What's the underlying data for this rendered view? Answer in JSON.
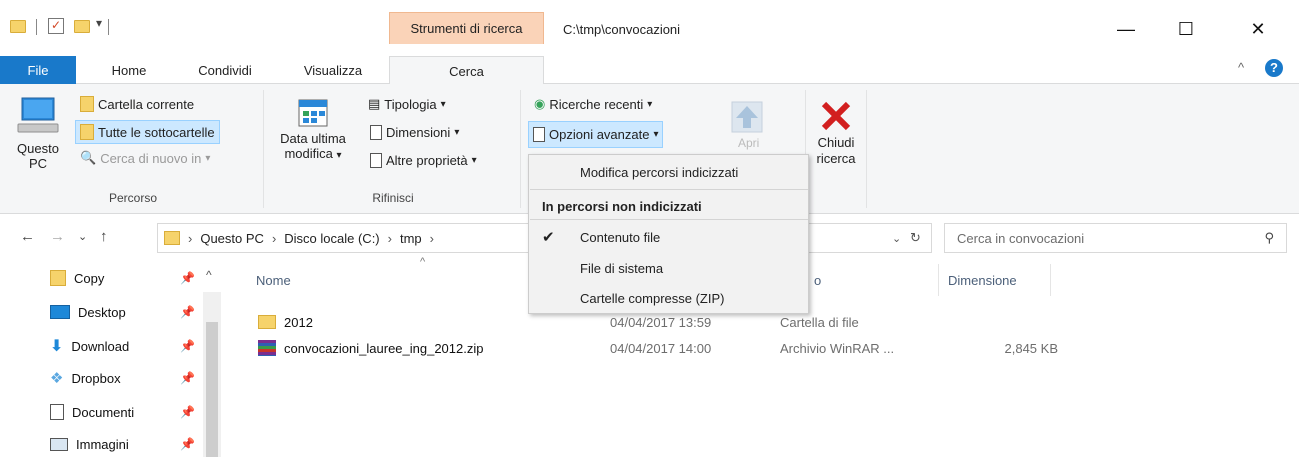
{
  "window": {
    "context_tab_header": "Strumenti di ricerca",
    "path_title": "C:\\tmp\\convocazioni",
    "minimize": "—",
    "maximize": "☐",
    "close": "✕"
  },
  "tabs": {
    "file": "File",
    "home": "Home",
    "condividi": "Condividi",
    "visualizza": "Visualizza",
    "cerca": "Cerca"
  },
  "ribbon": {
    "percorso": {
      "questo_pc": "Questo PC",
      "cartella_corrente": "Cartella corrente",
      "tutte_sottocartelle": "Tutte le sottocartelle",
      "cerca_di_nuovo": "Cerca di nuovo in",
      "label": "Percorso"
    },
    "rifinisci": {
      "data_ultima_modifica_1": "Data ultima",
      "data_ultima_modifica_2": "modifica",
      "tipologia": "Tipologia",
      "dimensioni": "Dimensioni",
      "altre_proprieta": "Altre proprietà",
      "label": "Rifinisci"
    },
    "opzioni": {
      "ricerche_recenti": "Ricerche recenti",
      "opzioni_avanzate": "Opzioni avanzate",
      "apri_label": "Apri"
    },
    "chiudi": {
      "line1": "Chiudi",
      "line2": "ricerca"
    }
  },
  "dropdown": {
    "modifica_percorsi": "Modifica percorsi indicizzati",
    "header": "In percorsi non indicizzati",
    "contenuto_file": "Contenuto file",
    "contenuto_file_checked": true,
    "file_di_sistema": "File di sistema",
    "cartelle_compresse": "Cartelle compresse (ZIP)"
  },
  "navbar": {
    "breadcrumb": [
      "Questo PC",
      "Disco locale (C:)",
      "tmp"
    ],
    "search_placeholder": "Cerca in convocazioni"
  },
  "sidebar": {
    "items": [
      {
        "label": "Copy",
        "icon": "folder-icon"
      },
      {
        "label": "Desktop",
        "icon": "desktop-icon"
      },
      {
        "label": "Download",
        "icon": "download-icon"
      },
      {
        "label": "Dropbox",
        "icon": "dropbox-icon"
      },
      {
        "label": "Documenti",
        "icon": "documents-icon"
      },
      {
        "label": "Immagini",
        "icon": "pictures-icon"
      }
    ]
  },
  "columns": {
    "nome": "Nome",
    "tipo_partial": "o",
    "dimensione": "Dimensione"
  },
  "files": [
    {
      "name": "2012",
      "date": "04/04/2017 13:59",
      "type": "Cartella di file",
      "size": ""
    },
    {
      "name": "convocazioni_lauree_ing_2012.zip",
      "date": "04/04/2017 14:00",
      "type": "Archivio WinRAR ...",
      "size": "2,845 KB"
    }
  ],
  "colors": {
    "accent": "#1979ca",
    "context_tab": "#fad3b8",
    "selection": "#cce8ff",
    "close_red": "#d21f1f"
  }
}
